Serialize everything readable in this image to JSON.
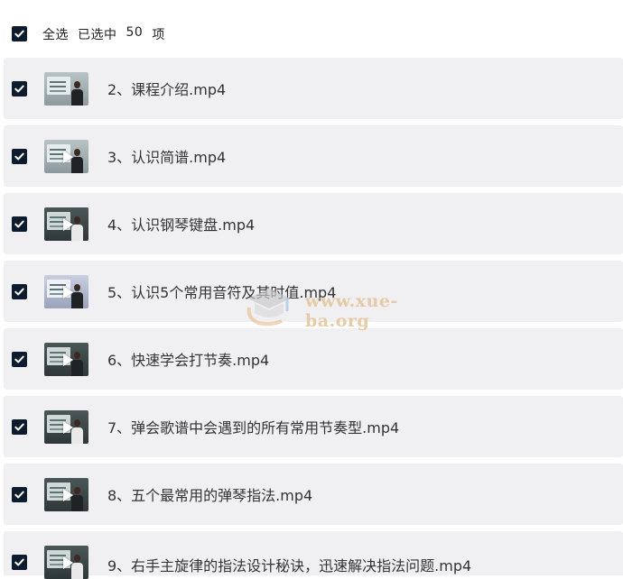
{
  "header": {
    "select_all_label": "全选",
    "selected_prefix": "已选中",
    "selected_count": "50",
    "selected_suffix": "项"
  },
  "files": [
    {
      "name": "2、课程介绍.mp4",
      "thumb": "lecture-thumbnail",
      "play": false
    },
    {
      "name": "3、认识简谱.mp4",
      "thumb": "lecture-thumbnail",
      "play": true
    },
    {
      "name": "4、认识钢琴键盘.mp4",
      "thumb": "lecture-thumbnail",
      "play": true
    },
    {
      "name": "5、认识5个常用音符及其时值.mp4",
      "thumb": "lecture-thumbnail",
      "play": true
    },
    {
      "name": "6、快速学会打节奏.mp4",
      "thumb": "lecture-thumbnail",
      "play": true
    },
    {
      "name": "7、弹会歌谱中会遇到的所有常用节奏型.mp4",
      "thumb": "lecture-thumbnail",
      "play": true
    },
    {
      "name": "8、五个最常用的弹琴指法.mp4",
      "thumb": "lecture-thumbnail",
      "play": true
    },
    {
      "name": "9、右手主旋律的指法设计秘诀，迅速解决指法问题.mp4",
      "thumb": "lecture-thumbnail",
      "play": true
    }
  ],
  "watermark": {
    "text": "www.xue-ba.org"
  },
  "colors": {
    "checkbox": "#0d1b2e",
    "row_background": "#f0f0f2",
    "watermark_text": "#e5c49a"
  }
}
